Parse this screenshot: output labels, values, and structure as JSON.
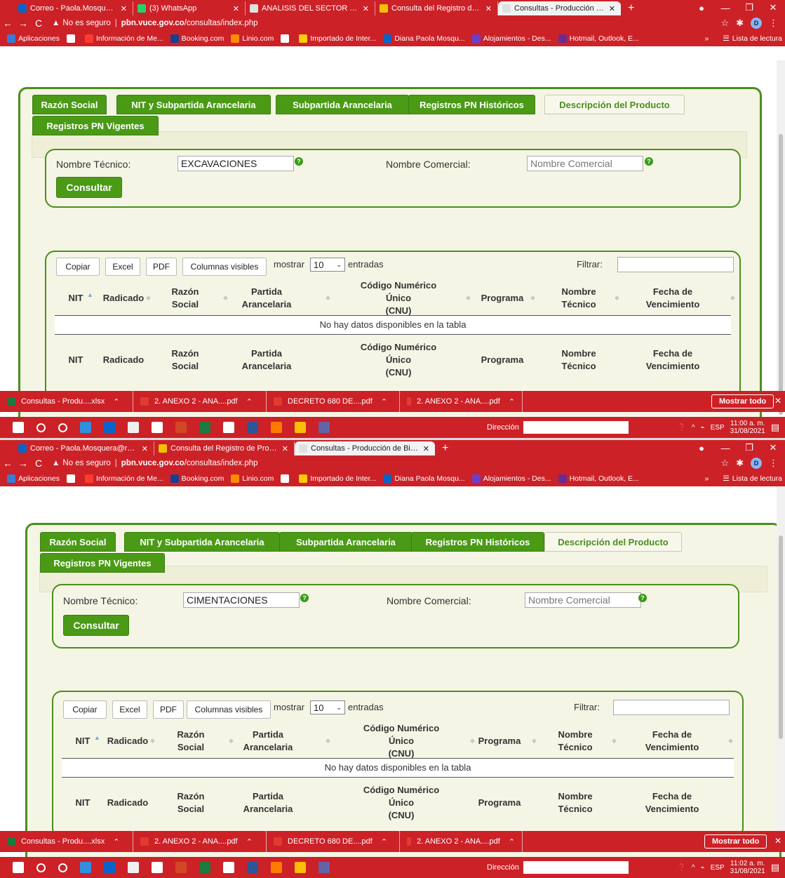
{
  "colors": {
    "browser_accent": "#cc2127",
    "brand_green": "#4a9a16",
    "panel_bg": "#f5f5e6"
  },
  "screens": [
    {
      "tabs": [
        {
          "title": "Correo - Paola.Mosquera@re",
          "icon": "outlook-icon"
        },
        {
          "title": "(3) WhatsApp",
          "icon": "whatsapp-icon"
        },
        {
          "title": "ANALISIS DEL SECTOR Y ESTU",
          "icon": "chrome-icon"
        },
        {
          "title": "Consulta del Registro de Pro",
          "icon": "emoji-icon"
        },
        {
          "title": "Consultas - Producción de Bi",
          "icon": "chrome-icon"
        }
      ],
      "url_warning": "No es seguro",
      "url_host": "pbn.vuce.gov.co",
      "url_path": "/consultas/index.php",
      "nombre_tecnico_value": "EXCAVACIONES",
      "clock_time": "11:00 a. m.",
      "clock_date": "31/08/2021"
    },
    {
      "tabs": [
        {
          "title": "Correo - Paola.Mosquera@renov",
          "icon": "outlook-icon"
        },
        {
          "title": "Consulta del Registro de Product",
          "icon": "emoji-icon"
        },
        {
          "title": "Consultas - Producción de Biene",
          "icon": "chrome-icon"
        }
      ],
      "url_warning": "No es seguro",
      "url_host": "pbn.vuce.gov.co",
      "url_path": "/consultas/index.php",
      "nombre_tecnico_value": "CIMENTACIONES",
      "clock_time": "11:02 a. m.",
      "clock_date": "31/08/2021"
    }
  ],
  "bookmarks": {
    "items": [
      "Aplicaciones",
      "",
      "Información de Me...",
      "Booking.com",
      "Linio.com",
      "",
      "Importado de Inter...",
      "Diana Paola Mosqu...",
      "Alojamientos - Des...",
      "Hotmail, Outlook, E..."
    ],
    "more": "»",
    "reading_list": "Lista de lectura"
  },
  "profile_initial": "D",
  "page_tabs": [
    "Razón Social",
    "NIT y Subpartida Arancelaria",
    "Subpartida Arancelaria",
    "Registros PN Históricos",
    "Descripción del Producto",
    "Registros PN Vigentes"
  ],
  "form": {
    "nombre_tecnico_label": "Nombre Técnico:",
    "nombre_comercial_label": "Nombre Comercial:",
    "nombre_comercial_placeholder": "Nombre Comercial",
    "consultar": "Consultar",
    "help": "?"
  },
  "table": {
    "buttons": [
      "Copiar",
      "Excel",
      "PDF",
      "Columnas visibles"
    ],
    "show_label": "mostrar",
    "page_size": "10",
    "entries_label": "entradas",
    "filter_label": "Filtrar:",
    "columns": [
      [
        "NIT"
      ],
      [
        "Radicado"
      ],
      [
        "Razón",
        "Social"
      ],
      [
        "Partida",
        "Arancelaria"
      ],
      [
        "Código Numérico Único",
        "(CNU)"
      ],
      [
        "Programa"
      ],
      [
        "Nombre",
        "Técnico"
      ],
      [
        "Fecha de",
        "Vencimiento"
      ]
    ],
    "empty_message": "No hay datos disponibles en la tabla"
  },
  "downloads": {
    "items": [
      "Consultas - Produ....xlsx",
      "2. ANEXO 2 - ANA....pdf",
      "DECRETO 680 DE....pdf",
      "2. ANEXO 2 - ANA....pdf"
    ],
    "show_all": "Mostrar todo"
  },
  "taskbar": {
    "address_label": "Dirección",
    "lang": "ESP"
  }
}
